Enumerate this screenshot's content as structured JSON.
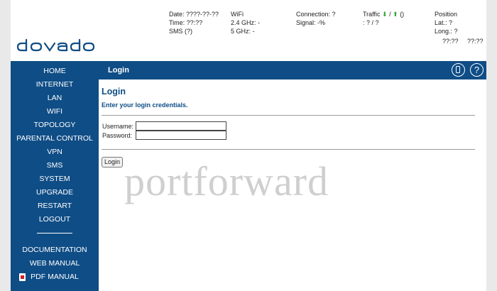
{
  "header": {
    "logo_text": "dovado",
    "date": "Date: ????-??-??",
    "time": "Time: ??:??",
    "sms": "SMS (?)",
    "wifi": "WiFi",
    "wifi24": "2.4 GHz: -",
    "wifi5": "5 GHz: -",
    "connection": "Connection: ?",
    "signal": "Signal: -%",
    "traffic_label": "Traffic",
    "traffic_sep": "/",
    "traffic_val": "()",
    "traffic_ratio": ": ? / ?",
    "position": "Position",
    "lat": "Lat.: ?",
    "long": "Long.: ?",
    "pos_time1": "??:??",
    "pos_time2": "??:??"
  },
  "sidebar": {
    "items": [
      "HOME",
      "INTERNET",
      "LAN",
      "WIFI",
      "TOPOLOGY",
      "PARENTAL CONTROL",
      "VPN",
      "SMS",
      "SYSTEM",
      "UPGRADE",
      "RESTART",
      "LOGOUT"
    ],
    "bottom": [
      "DOCUMENTATION",
      "WEB MANUAL",
      "PDF MANUAL"
    ]
  },
  "bar": {
    "title": "Login"
  },
  "login": {
    "heading": "Login",
    "subtitle": "Enter your login credentials.",
    "username_label": "Username:",
    "password_label": "Password:",
    "username_value": "",
    "password_value": "",
    "button": "Login"
  },
  "watermark": "portforward",
  "colors": {
    "brand": "#0f4d86",
    "traffic_arrow": "#2ea52e"
  }
}
